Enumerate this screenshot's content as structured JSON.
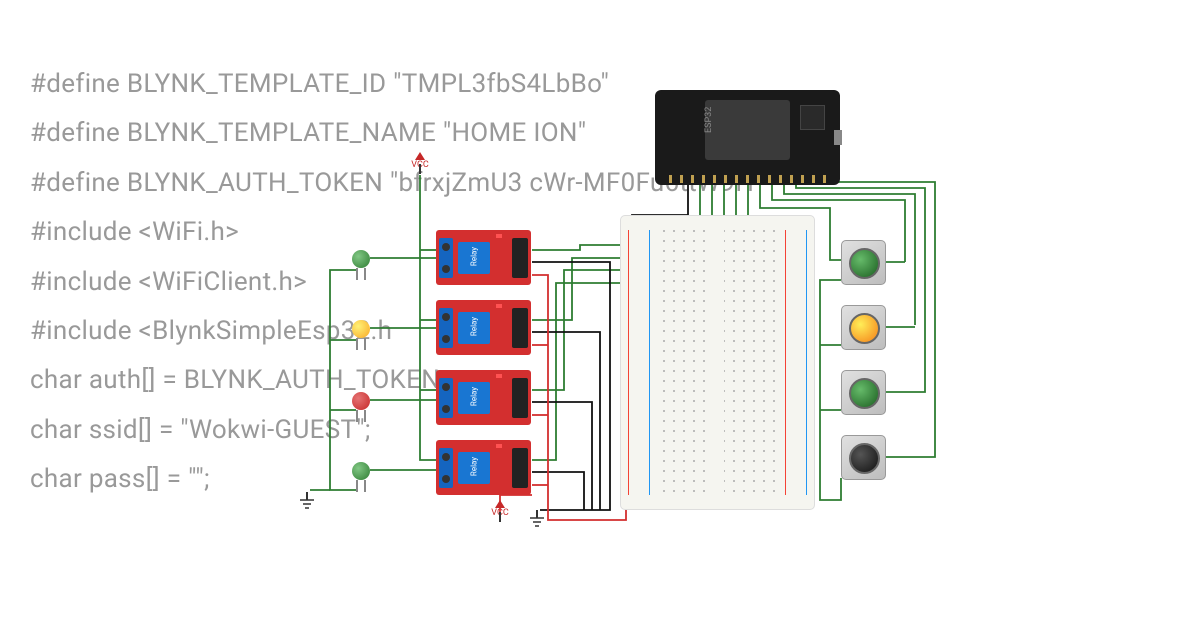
{
  "code": {
    "line1": "#define BLYNK_TEMPLATE_ID \"TMPL3fbS4LbBo\"",
    "line2": "#define BLYNK_TEMPLATE_NAME \"HOME                     ION\"",
    "line3": "#define BLYNK_AUTH_TOKEN \"bfrxjZmU3              cWr-MF0Fu6ttW9H\"",
    "line4": "",
    "line5": "#include <WiFi.h>",
    "line6": "#include <WiFiClient.h>",
    "line7": "#include <BlynkSimpleEsp32.h",
    "line8": "",
    "line9": "char auth[] = BLYNK_AUTH_TOKEN;",
    "line10": "",
    "line11": "char ssid[] = \"Wokwi-GUEST\";",
    "line12": "char pass[] = \"\";"
  },
  "components": {
    "microcontroller": "ESP32",
    "relay_label": "Relay",
    "relays": [
      {
        "id": 1,
        "connected_led": "green"
      },
      {
        "id": 2,
        "connected_led": "yellow"
      },
      {
        "id": 3,
        "connected_led": "red"
      },
      {
        "id": 4,
        "connected_led": "green"
      }
    ],
    "leds": [
      {
        "pos": 1,
        "color": "green"
      },
      {
        "pos": 2,
        "color": "yellow"
      },
      {
        "pos": 3,
        "color": "red"
      },
      {
        "pos": 4,
        "color": "green"
      }
    ],
    "buttons": [
      {
        "pos": 1,
        "color": "green"
      },
      {
        "pos": 2,
        "color": "yellow"
      },
      {
        "pos": 3,
        "color": "green"
      },
      {
        "pos": 4,
        "color": "black"
      }
    ],
    "power": {
      "vcc_label": "VCC",
      "gnd_count": 2,
      "vcc_count": 2
    }
  },
  "wiring_colors": {
    "signal": "#2e7d32",
    "ground": "#111111",
    "power": "#d32f2f"
  }
}
